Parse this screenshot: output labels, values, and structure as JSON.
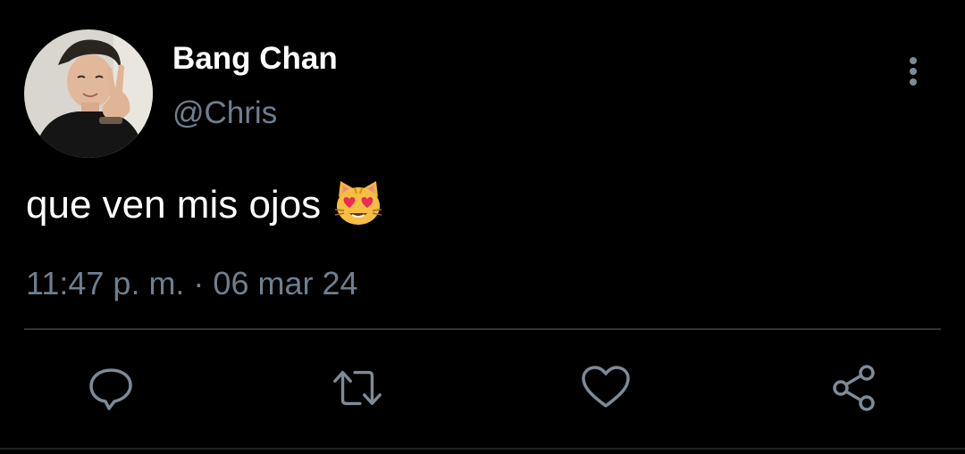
{
  "tweet": {
    "display_name": "Bang Chan",
    "handle": "@Chris",
    "text": "que ven mis ojos",
    "emoji": "smiling-cat-with-heart-eyes",
    "timestamp": "11:47 p. m. · 06 mar 24"
  },
  "actions": [
    {
      "icon": "reply-icon"
    },
    {
      "icon": "retweet-icon"
    },
    {
      "icon": "like-icon"
    },
    {
      "icon": "share-icon"
    }
  ],
  "colors": {
    "background": "#000000",
    "primary_text": "#ffffff",
    "secondary_text": "#6e7f8e",
    "icon": "#7d8b98",
    "divider": "#2f3336"
  }
}
